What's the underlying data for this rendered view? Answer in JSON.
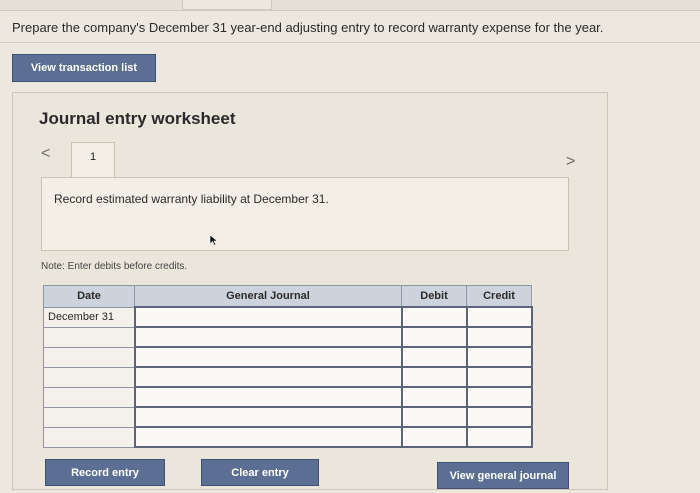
{
  "question": "Prepare the company's December 31 year-end adjusting entry to record warranty expense for the year.",
  "buttons": {
    "view_transaction_list": "View transaction list",
    "record_entry": "Record entry",
    "clear_entry": "Clear entry",
    "view_general_journal": "View general journal"
  },
  "worksheet": {
    "title": "Journal entry worksheet",
    "nav_prev": "<",
    "nav_next": ">",
    "step": "1",
    "instruction": "Record estimated warranty liability at December 31.",
    "note": "Note: Enter debits before credits."
  },
  "table": {
    "headers": {
      "date": "Date",
      "general_journal": "General Journal",
      "debit": "Debit",
      "credit": "Credit"
    },
    "rows": [
      {
        "date": "December 31",
        "general_journal": "",
        "debit": "",
        "credit": ""
      },
      {
        "date": "",
        "general_journal": "",
        "debit": "",
        "credit": ""
      },
      {
        "date": "",
        "general_journal": "",
        "debit": "",
        "credit": ""
      },
      {
        "date": "",
        "general_journal": "",
        "debit": "",
        "credit": ""
      },
      {
        "date": "",
        "general_journal": "",
        "debit": "",
        "credit": ""
      },
      {
        "date": "",
        "general_journal": "",
        "debit": "",
        "credit": ""
      },
      {
        "date": "",
        "general_journal": "",
        "debit": "",
        "credit": ""
      }
    ]
  }
}
